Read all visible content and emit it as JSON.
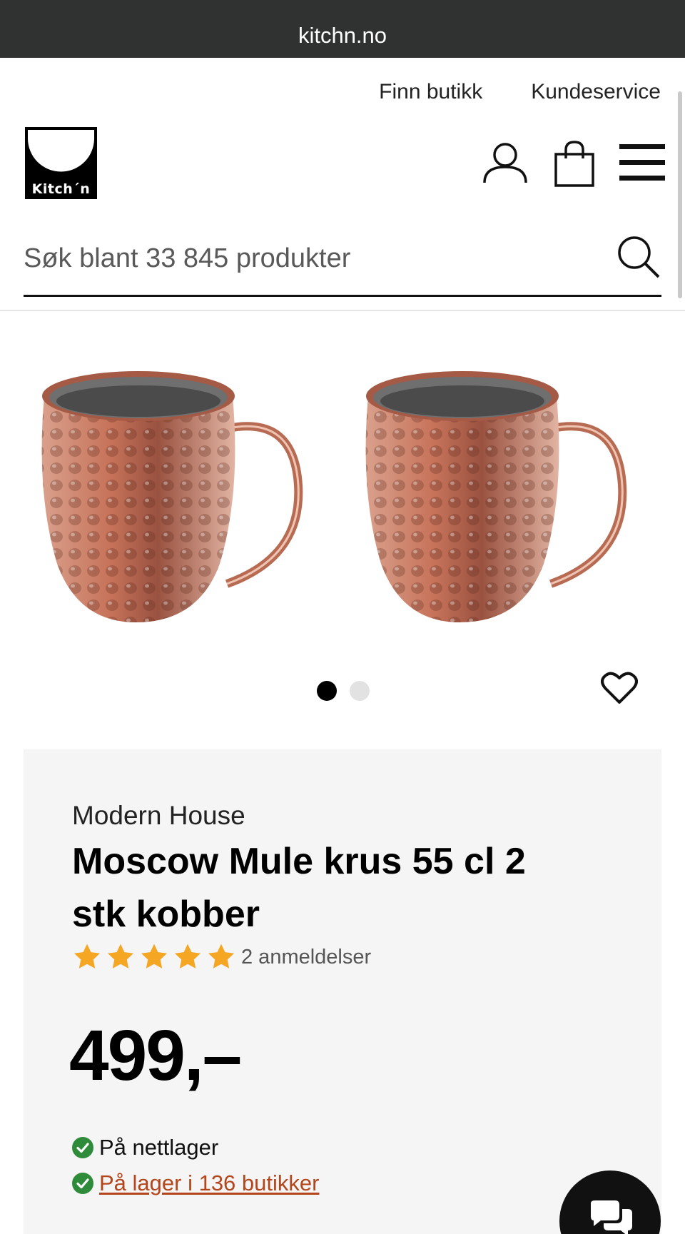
{
  "browser": {
    "url": "kitchn.no"
  },
  "header": {
    "links": [
      "Finn butikk",
      "Kundeservice"
    ],
    "logo_text": "Kitch´n",
    "icons": [
      "account-icon",
      "shopping-bag-icon",
      "menu-icon"
    ]
  },
  "search": {
    "placeholder": "Søk blant 33 845 produkter"
  },
  "gallery": {
    "image_count": 2,
    "active_index": 0
  },
  "product": {
    "brand": "Modern House",
    "title": "Moscow Mule krus 55 cl 2 stk kobber",
    "rating": {
      "stars": 5,
      "out_of": 5,
      "reviews_label": "2 anmeldelser"
    },
    "price": "499,–",
    "stock_online": "På nettlager",
    "stock_stores": "På lager i 136 butikker"
  },
  "colors": {
    "urlbar": "#2f3231",
    "panel": "#f5f5f5",
    "star": "#f5a623",
    "check": "#2e8b3a",
    "link": "#b5461c"
  }
}
